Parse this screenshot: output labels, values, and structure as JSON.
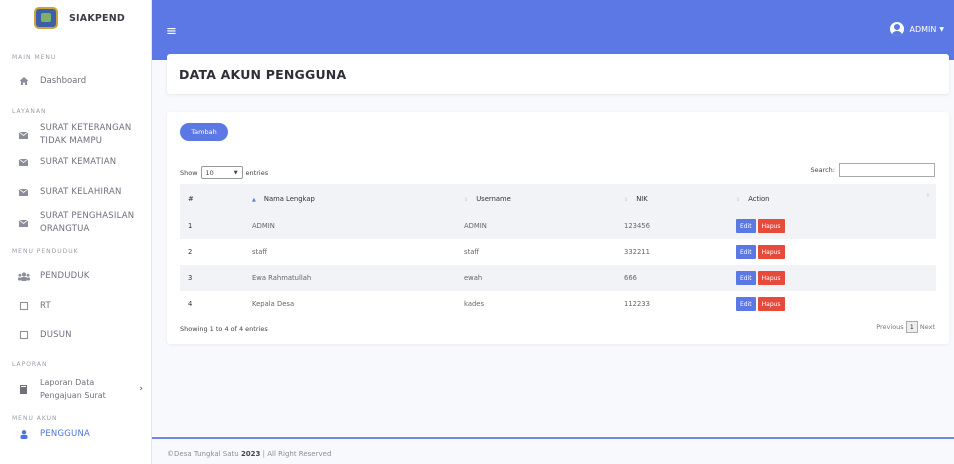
{
  "brand": {
    "name": "SIAKPEND"
  },
  "sidebar": {
    "main_menu_title": "MAIN MENU",
    "dashboard": "Dashboard",
    "layanan_title": "LAYANAN",
    "layanan_items": [
      "SURAT KETERANGAN TIDAK MAMPU",
      "SURAT KEMATIAN",
      "SURAT KELAHIRAN",
      "SURAT PENGHASILAN ORANGTUA"
    ],
    "penduduk_title": "MENU PENDUDUK",
    "penduduk_items": [
      "PENDUDUK",
      "RT",
      "DUSUN"
    ],
    "laporan_title": "LAPORAN",
    "laporan_item": "Laporan Data Pengajuan Surat",
    "akun_title": "MENU AKUN",
    "akun_item": "PENGGUNA"
  },
  "topbar": {
    "user": "ADMIN"
  },
  "page": {
    "title": "DATA AKUN PENGGUNA"
  },
  "table_controls": {
    "add_label": "Tambah",
    "show_label": "Show",
    "page_size": "10",
    "entries_label": "entries",
    "search_label": "Search:"
  },
  "table": {
    "headers": [
      "#",
      "Nama Lengkap",
      "Username",
      "NIK",
      "Action"
    ],
    "rows": [
      {
        "no": "1",
        "nama": "ADMIN",
        "username": "ADMIN",
        "nik": "123456"
      },
      {
        "no": "2",
        "nama": "staff",
        "username": "staff",
        "nik": "332211"
      },
      {
        "no": "3",
        "nama": "Ewa Rahmatullah",
        "username": "ewah",
        "nik": "666"
      },
      {
        "no": "4",
        "nama": "Kepala Desa",
        "username": "kades",
        "nik": "112233"
      }
    ],
    "edit_label": "Edit",
    "delete_label": "Hapus"
  },
  "pagination": {
    "info": "Showing 1 to 4 of 4 entries",
    "previous": "Previous",
    "current": "1",
    "next": "Next"
  },
  "footer": {
    "prefix": "©Desa Tungkal Satu",
    "year": "2023",
    "suffix": "| All Right Reserved"
  },
  "colors": {
    "primary": "#5b78e4",
    "danger": "#e74a3b",
    "sidebar_bg": "#ffffff"
  }
}
